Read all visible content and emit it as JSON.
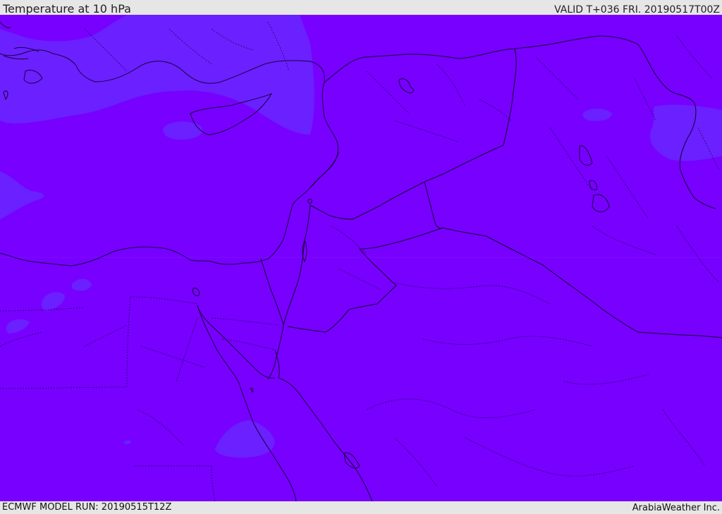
{
  "header": {
    "title": "Temperature at 10 hPa",
    "valid": "VALID T+036 FRI. 20190517T00Z"
  },
  "footer": {
    "model_run": "ECMWF MODEL RUN: 20190515T12Z",
    "credit": "ArabiaWeather Inc."
  },
  "map": {
    "region": "Eastern Mediterranean and Middle East",
    "field": "temperature",
    "colors": {
      "base_fill": "#7700ff",
      "colder_patch": "#6a1fff",
      "coastline": "#1a0040",
      "border": "#150033"
    }
  }
}
